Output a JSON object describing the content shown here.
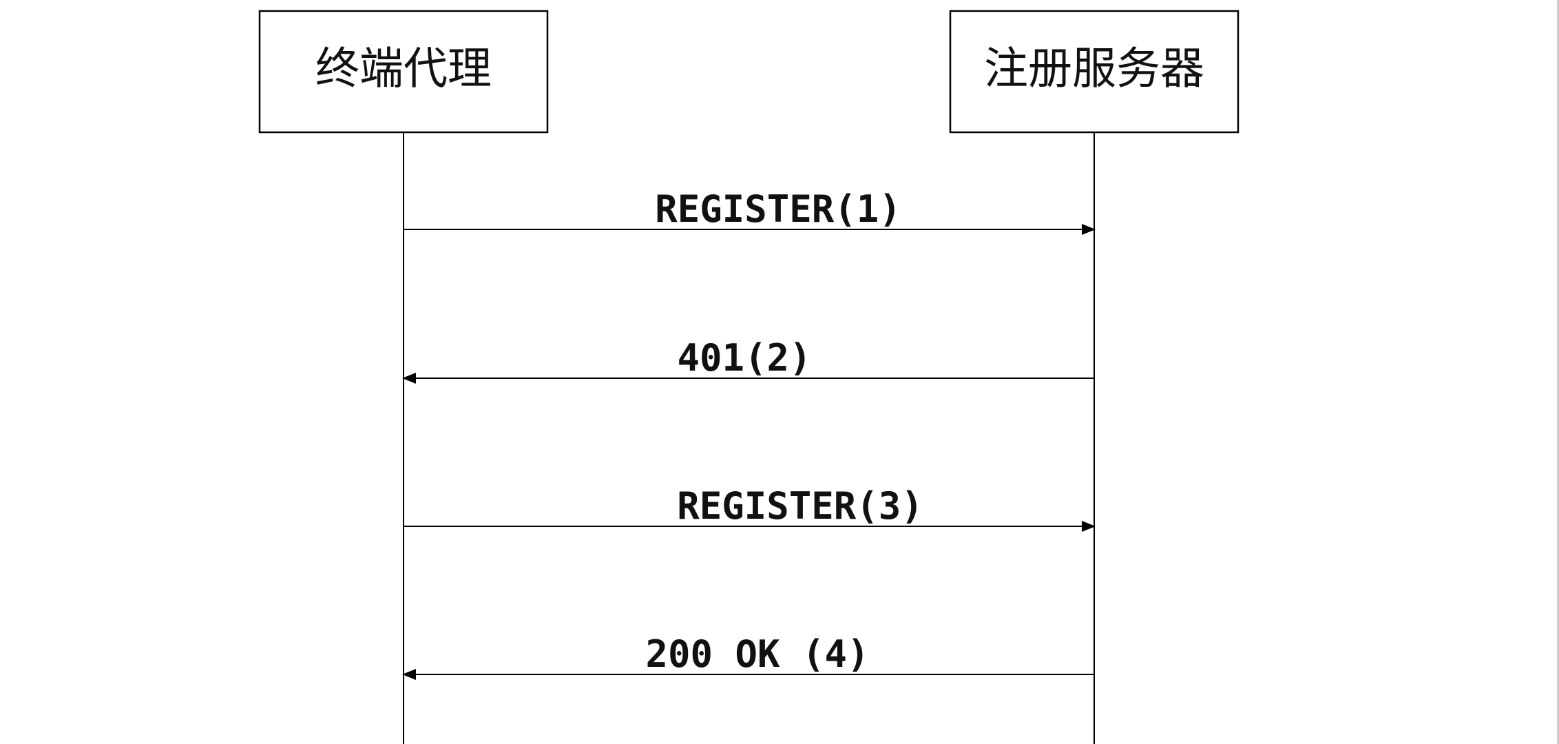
{
  "diagram": {
    "type": "sequence",
    "line_color": "#000000",
    "actors": [
      {
        "id": "terminal_agent",
        "label": "终端代理"
      },
      {
        "id": "registrar",
        "label": "注册服务器"
      }
    ],
    "messages": [
      {
        "id": "m1",
        "label": "REGISTER(1)",
        "from": "terminal_agent",
        "to": "registrar"
      },
      {
        "id": "m2",
        "label": "401(2)",
        "from": "registrar",
        "to": "terminal_agent"
      },
      {
        "id": "m3",
        "label": "REGISTER(3)",
        "from": "terminal_agent",
        "to": "registrar"
      },
      {
        "id": "m4",
        "label": "200 OK (4)",
        "from": "registrar",
        "to": "terminal_agent"
      }
    ]
  }
}
